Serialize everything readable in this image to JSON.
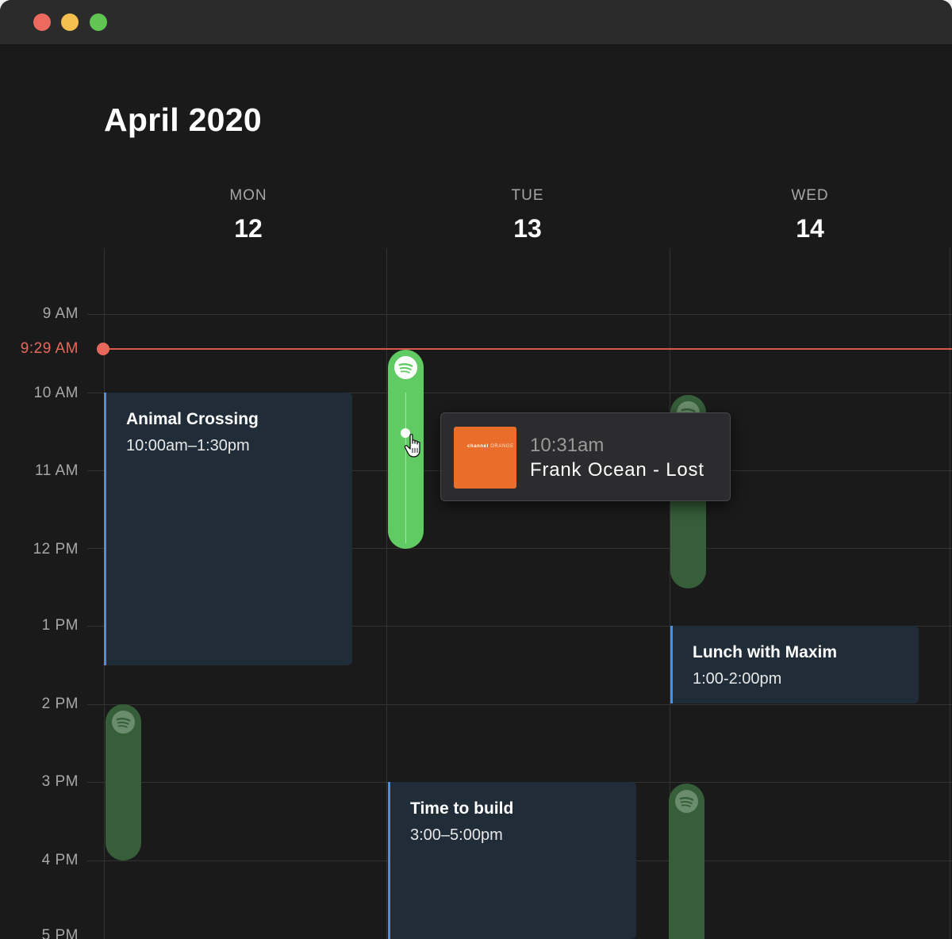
{
  "window": {
    "title": ""
  },
  "calendar": {
    "month_title": "April 2020"
  },
  "days": [
    {
      "name": "MON",
      "number": "12"
    },
    {
      "name": "TUE",
      "number": "13"
    },
    {
      "name": "WED",
      "number": "14"
    }
  ],
  "time_labels": [
    "9 AM",
    "10 AM",
    "11 AM",
    "12 PM",
    "1 PM",
    "2 PM",
    "3 PM",
    "4 PM",
    "5 PM"
  ],
  "now_indicator": {
    "label": "9:29 AM",
    "color": "#e8695c"
  },
  "events": [
    {
      "title": "Animal Crossing",
      "time": "10:00am–1:30pm",
      "day": "MON"
    },
    {
      "title": "Lunch with Maxim",
      "time": "1:00-2:00pm",
      "day": "WED"
    },
    {
      "title": "Time to build",
      "time": "3:00–5:00pm",
      "day": "TUE"
    }
  ],
  "spotify_blocks": [
    {
      "day": "TUE",
      "state": "active",
      "icon": "spotify-icon"
    },
    {
      "day": "WED",
      "state": "inactive",
      "icon": "spotify-icon"
    },
    {
      "day": "MON",
      "state": "inactive",
      "icon": "spotify-icon"
    },
    {
      "day": "WED",
      "state": "inactive",
      "icon": "spotify-icon"
    }
  ],
  "now_playing_popup": {
    "time": "10:31am",
    "track": "Frank Ocean - Lost",
    "album_art_text": {
      "line1": "channel",
      "line2": "ORANGE"
    }
  },
  "colors": {
    "background": "#1a1a1a",
    "event_fill": "#202c38",
    "event_accent": "#4a90e2",
    "spotify_active": "#5fcb62",
    "spotify_inactive": "#365e39",
    "album_orange": "#ea6e2a"
  }
}
